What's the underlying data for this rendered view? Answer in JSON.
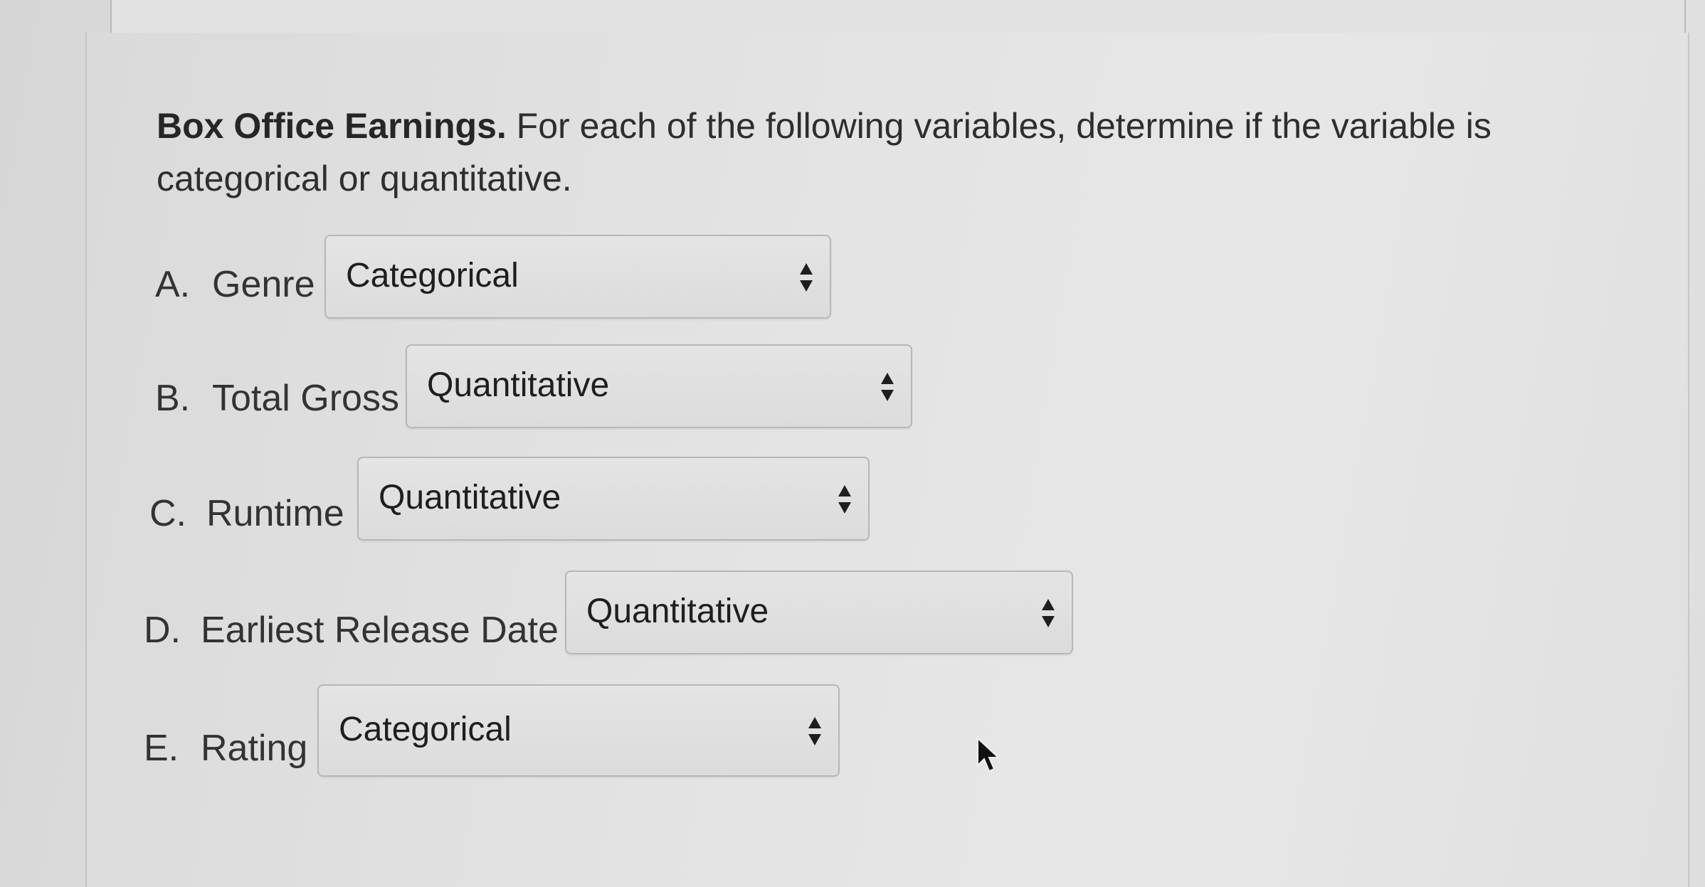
{
  "question": {
    "title": "Box Office Earnings.",
    "text": " For each of the following variables, determine if the variable is categorical or quantitative."
  },
  "items": [
    {
      "letter": "A.",
      "variable": "Genre",
      "selected": "Categorical"
    },
    {
      "letter": "B.",
      "variable": "Total Gross",
      "selected": "Quantitative"
    },
    {
      "letter": "C.",
      "variable": "Runtime",
      "selected": "Quantitative"
    },
    {
      "letter": "D.",
      "variable": "Earliest Release Date",
      "selected": "Quantitative"
    },
    {
      "letter": "E.",
      "variable": "Rating",
      "selected": "Categorical"
    }
  ],
  "icons": {
    "select_arrows": "up-down-arrows-icon",
    "cursor": "mouse-pointer-icon"
  }
}
